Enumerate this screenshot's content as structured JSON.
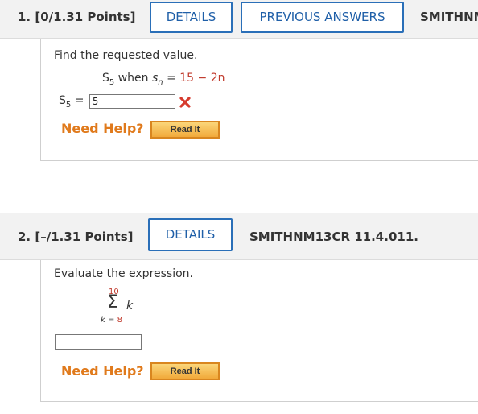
{
  "q1": {
    "number": "1.",
    "points": "[0/1.31 Points]",
    "details": "DETAILS",
    "previous_answers": "PREVIOUS ANSWERS",
    "ref": "SMITHNM",
    "prompt": "Find the requested value.",
    "given_var": "S",
    "given_sub": "5",
    "when": "when",
    "s_var": "s",
    "n_sub": "n",
    "eq": "=",
    "expr": "15 − 2n",
    "label_var": "S",
    "label_sub": "5",
    "label_eq": "=",
    "answer_value": "5",
    "need_help": "Need Help?",
    "read_it": "Read It"
  },
  "q2": {
    "number": "2.",
    "points": "[–/1.31 Points]",
    "details": "DETAILS",
    "ref": "SMITHNM13CR 11.4.011.",
    "prompt": "Evaluate the expression.",
    "sum_upper": "10",
    "sum_symbol": "Σ",
    "sum_term": "k",
    "sum_lower_var": "k",
    "sum_lower_eq": "=",
    "sum_lower_val": "8",
    "answer_value": "",
    "need_help": "Need Help?",
    "read_it": "Read It"
  },
  "colors": {
    "accent": "#2a6fb8",
    "need_help": "#e07a1c",
    "error": "#d63b2e",
    "header_bg": "#f2f2f2"
  },
  "icons": {
    "incorrect": "x-icon"
  }
}
